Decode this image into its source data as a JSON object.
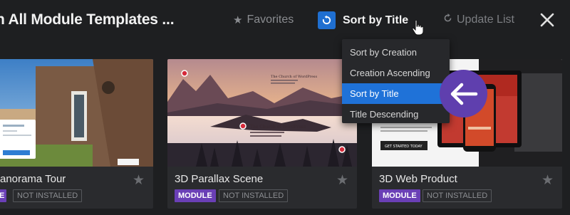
{
  "header": {
    "title": "h All Module Templates ...",
    "favorites_label": "Favorites",
    "sort_label": "Sort by Title",
    "update_label": "Update List"
  },
  "dropdown": {
    "options": [
      "Sort by Creation",
      "Creation Ascending",
      "Sort by Title",
      "Title Descending"
    ],
    "selected": "Sort by Title"
  },
  "cards": [
    {
      "title": "anorama Tour",
      "badge": "E",
      "status": "NOT INSTALLED"
    },
    {
      "title": "3D Parallax Scene",
      "badge": "MODULE",
      "status": "NOT INSTALLED"
    },
    {
      "title": "3D Web Product",
      "badge": "MODULE",
      "status": "NOT INSTALLED"
    }
  ],
  "thumb_text": {
    "parallax_heading": "The Church of WordPress",
    "cta": "GET STARTED TODAY"
  },
  "colors": {
    "background": "#1e1f21",
    "card": "#2a2b2e",
    "accent_blue": "#1f72d8",
    "module_purple": "#6a3fb6",
    "arrow_purple": "#5f3fae"
  },
  "icons": {
    "favorites": "star-icon",
    "sort": "refresh-icon",
    "update": "refresh-icon",
    "close": "close-icon",
    "pointer": "arrow-left-icon"
  }
}
